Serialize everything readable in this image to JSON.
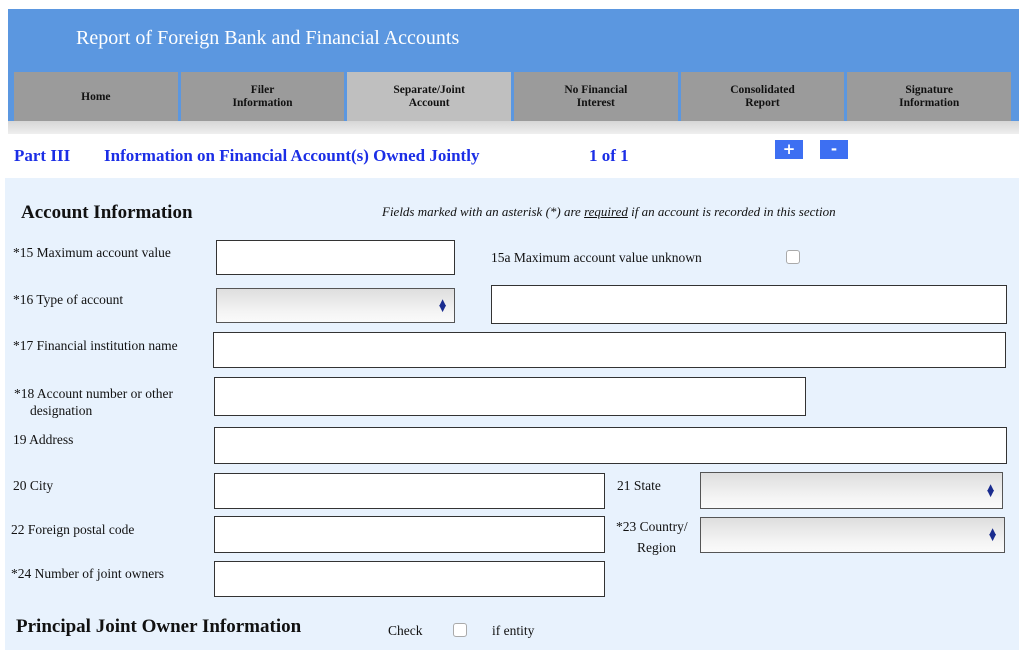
{
  "header": {
    "title": "Report of Foreign Bank and Financial Accounts"
  },
  "tabs": [
    {
      "label": "Home",
      "active": false
    },
    {
      "label": "Filer\nInformation",
      "active": false
    },
    {
      "label": "Separate/Joint\nAccount",
      "active": true
    },
    {
      "label": "No Financial\nInterest",
      "active": false
    },
    {
      "label": "Consolidated\nReport",
      "active": false
    },
    {
      "label": "Signature\nInformation",
      "active": false
    }
  ],
  "part": {
    "number": "Part III",
    "title": "Information on Financial Account(s) Owned Jointly",
    "page_indicator": "1 of 1",
    "add_label": "+",
    "remove_label": "-"
  },
  "account_info": {
    "heading": "Account Information",
    "note_pre": "Fields marked with an asterisk (*) are ",
    "note_required": "required",
    "note_post": " if an account is recorded in this section",
    "fields": {
      "max_value": {
        "label": "*15 Maximum account value",
        "value": ""
      },
      "max_value_unknown": {
        "label": "15a Maximum account value unknown",
        "checked": false
      },
      "account_type": {
        "label": "*16 Type of account",
        "selected": "",
        "other_value": ""
      },
      "institution_name": {
        "label": "*17 Financial institution name",
        "value": ""
      },
      "account_number": {
        "label_line1": "*18 Account number or other",
        "label_line2": "designation",
        "value": ""
      },
      "address": {
        "label": "19  Address",
        "value": ""
      },
      "city": {
        "label": "20  City",
        "value": ""
      },
      "state": {
        "label": "21 State",
        "selected": ""
      },
      "postal_code": {
        "label": "22 Foreign postal code",
        "value": ""
      },
      "country": {
        "label_line1": "*23 Country/",
        "label_line2": "Region",
        "selected": ""
      },
      "joint_owners": {
        "label": "*24 Number of joint owners",
        "value": ""
      }
    }
  },
  "principal_owner": {
    "heading": "Principal Joint Owner Information",
    "check_label": "Check",
    "entity_label": "if entity",
    "is_entity": false
  }
}
